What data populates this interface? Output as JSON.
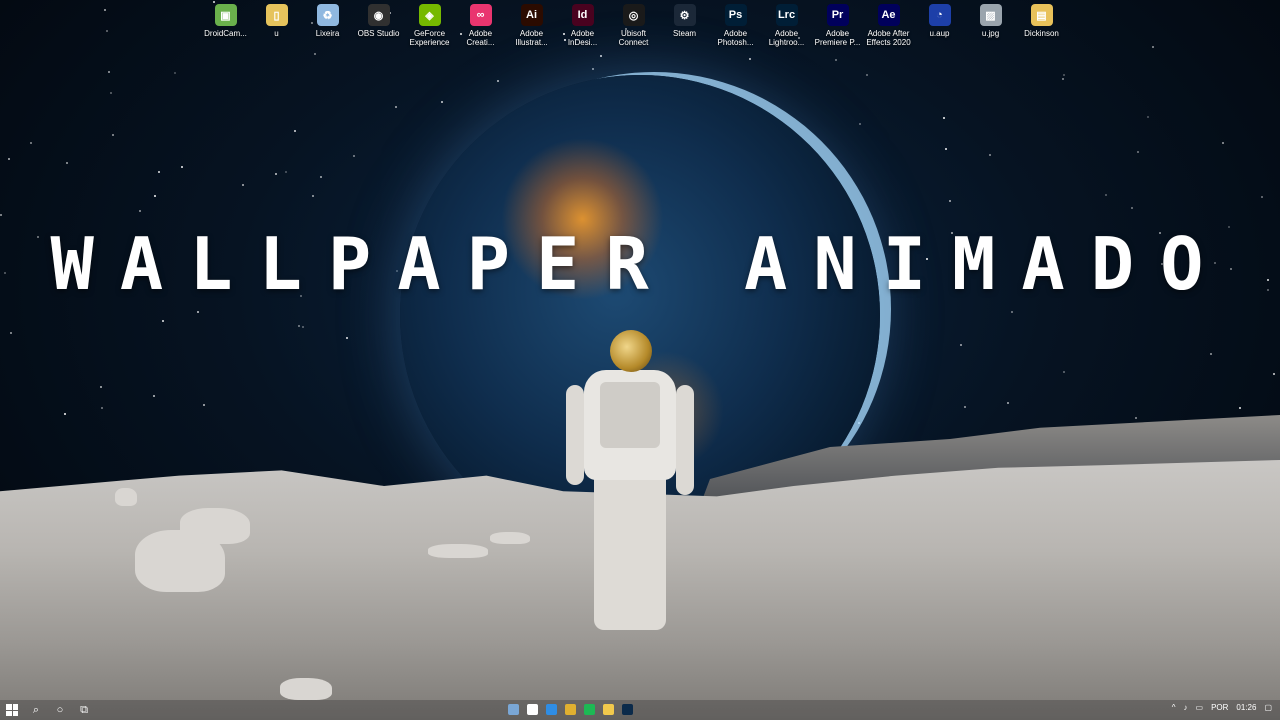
{
  "headline": "WALLPAPER ANIMADO",
  "desktop_icons": [
    {
      "label": "DroidCam...",
      "icon": "droidcam-icon",
      "color": "#6ab04c",
      "glyph": "▣"
    },
    {
      "label": "u",
      "icon": "file-icon",
      "color": "#e6c35c",
      "glyph": "▯"
    },
    {
      "label": "Lixeira",
      "icon": "recycle-bin-icon",
      "color": "#8fb8e0",
      "glyph": "♻"
    },
    {
      "label": "OBS Studio",
      "icon": "obs-icon",
      "color": "#303030",
      "glyph": "◉"
    },
    {
      "label": "GeForce Experience",
      "icon": "geforce-icon",
      "color": "#76b900",
      "glyph": "◈"
    },
    {
      "label": "Adobe Creati...",
      "icon": "creative-cloud-icon",
      "color": "#e9356f",
      "glyph": "∞"
    },
    {
      "label": "Adobe Illustrat...",
      "icon": "illustrator-icon",
      "color": "#2b0b00",
      "glyph": "Ai"
    },
    {
      "label": "Adobe InDesi...",
      "icon": "indesign-icon",
      "color": "#49021f",
      "glyph": "Id"
    },
    {
      "label": "Ubisoft Connect",
      "icon": "ubisoft-icon",
      "color": "#1a1a1a",
      "glyph": "◎"
    },
    {
      "label": "Steam",
      "icon": "steam-icon",
      "color": "#1b2838",
      "glyph": "⚙"
    },
    {
      "label": "Adobe Photosh...",
      "icon": "photoshop-icon",
      "color": "#001e36",
      "glyph": "Ps"
    },
    {
      "label": "Adobe Lightroo...",
      "icon": "lightroom-icon",
      "color": "#001e36",
      "glyph": "Lrc"
    },
    {
      "label": "Adobe Premiere P...",
      "icon": "premiere-icon",
      "color": "#00005b",
      "glyph": "Pr"
    },
    {
      "label": "Adobe After Effects 2020",
      "icon": "after-effects-icon",
      "color": "#00005b",
      "glyph": "Ae"
    },
    {
      "label": "u.aup",
      "icon": "audacity-icon",
      "color": "#1d3fa8",
      "glyph": "◔"
    },
    {
      "label": "u.jpg",
      "icon": "image-file-icon",
      "color": "#9aa4ad",
      "glyph": "▨"
    },
    {
      "label": "Dickinson",
      "icon": "folder-icon",
      "color": "#e8c15a",
      "glyph": "▤"
    }
  ],
  "taskbar": {
    "left_icons": [
      "search-icon",
      "cortana-icon",
      "task-view-icon"
    ],
    "apps": [
      {
        "icon": "app-icon-1",
        "color": "#7aa7d6"
      },
      {
        "icon": "store-icon",
        "color": "#ffffff"
      },
      {
        "icon": "mail-icon",
        "color": "#2f8de4"
      },
      {
        "icon": "chrome-icon",
        "color": "#e0b030"
      },
      {
        "icon": "spotify-icon",
        "color": "#1db954"
      },
      {
        "icon": "file-explorer-icon",
        "color": "#f2c94c"
      },
      {
        "icon": "photoshop-taskbar-icon",
        "color": "#0b2a4a"
      }
    ],
    "tray": {
      "language": "POR",
      "time": "01:26"
    }
  }
}
